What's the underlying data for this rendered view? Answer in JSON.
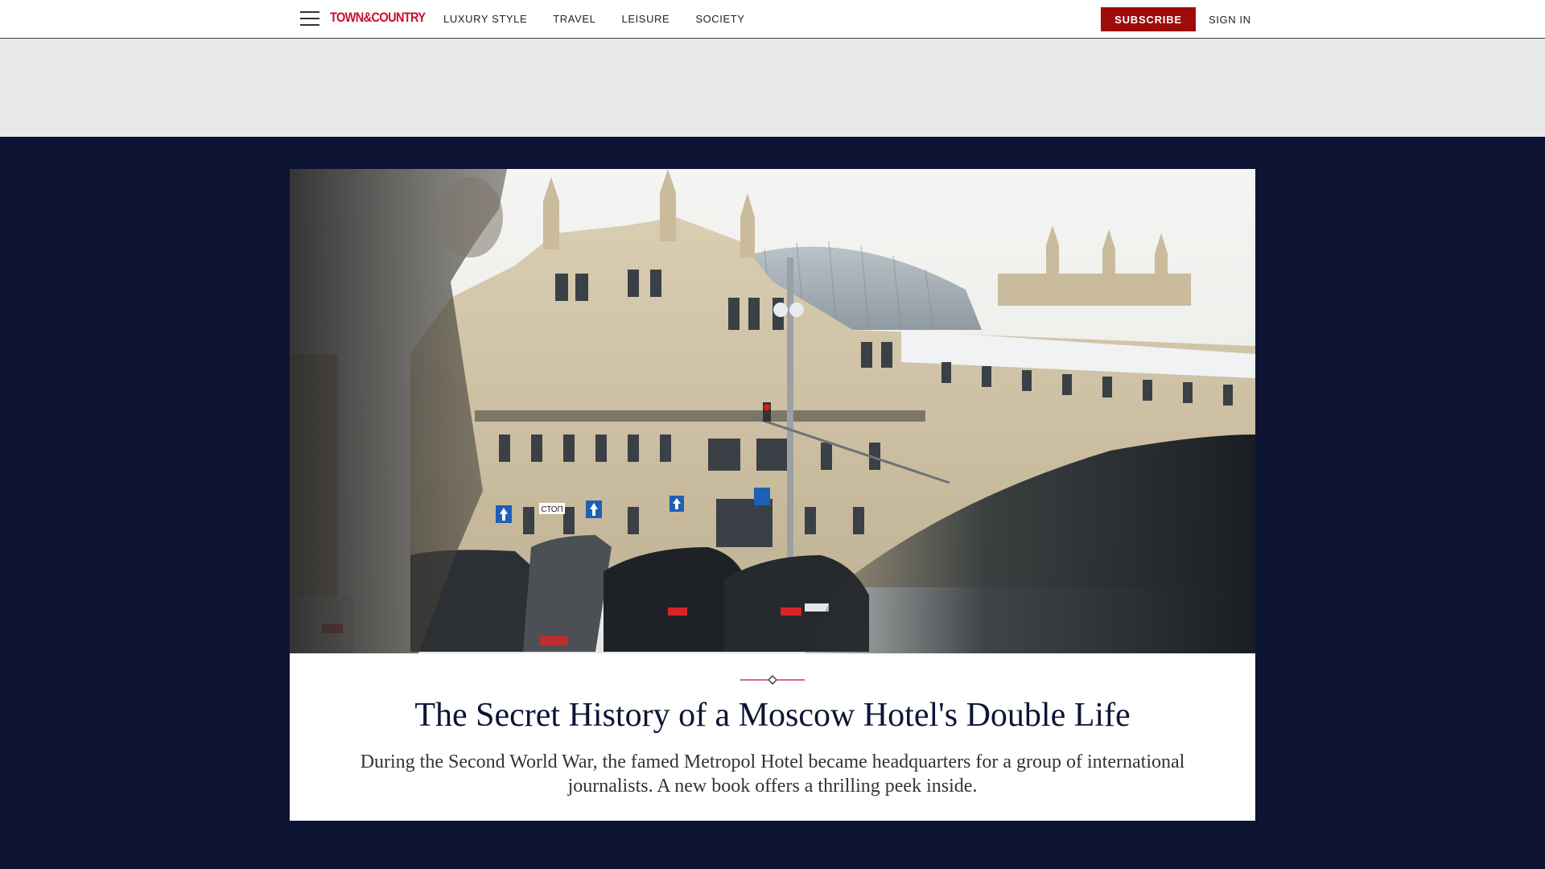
{
  "nav": {
    "logo": "TOWN&COUNTRY",
    "links": [
      "LUXURY STYLE",
      "TRAVEL",
      "LEISURE",
      "SOCIETY"
    ],
    "subscribe": "SUBSCRIBE",
    "sign_in": "SIGN IN"
  },
  "hero": {
    "headline": "The Secret History of a Moscow Hotel's Double Life",
    "dek": "During the Second World War, the famed Metropol Hotel became headquarters for a group of international journalists. A new book offers a thrilling peek inside.",
    "signs": {
      "stop": "СТОП"
    }
  },
  "colors": {
    "brand_red": "#c8102e",
    "subscribe_bg": "#9e0b0b",
    "hero_navy": "#0d1433"
  },
  "icons": [
    "hamburger-menu-icon",
    "ornament-divider-icon"
  ]
}
